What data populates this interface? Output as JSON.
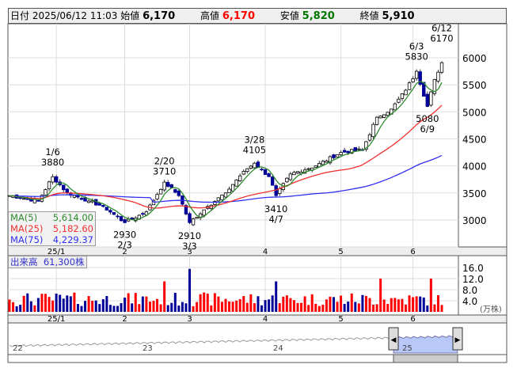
{
  "header": {
    "date_label": "日付",
    "datetime": "2025/06/12 11:03",
    "open_label": "始値",
    "open": "6,170",
    "high_label": "高値",
    "high": "6,170",
    "low_label": "安値",
    "low": "5,820",
    "close_label": "終値",
    "close": "5,910"
  },
  "ma_legend": [
    {
      "name": "MA(5)",
      "value": "5,614.00",
      "color": "#2e8b2e"
    },
    {
      "name": "MA(25)",
      "value": "5,182.60",
      "color": "#f03030"
    },
    {
      "name": "MA(75)",
      "value": "4,229.37",
      "color": "#3030f0"
    }
  ],
  "volume_legend": {
    "label": "出来高",
    "value": "61,300株"
  },
  "colors": {
    "up": "#ff0000",
    "down": "#000099"
  },
  "chart_data": {
    "type": "candlestick",
    "price_axis": {
      "ticks": [
        "6000",
        "5500",
        "5000",
        "4500",
        "4000",
        "3500",
        "3000"
      ],
      "range": [
        2500,
        6500
      ]
    },
    "x_labels": [
      {
        "label": "25/1",
        "day": 13
      },
      {
        "label": "2",
        "day": 32
      },
      {
        "label": "3",
        "day": 50
      },
      {
        "label": "4",
        "day": 71
      },
      {
        "label": "5",
        "day": 92
      },
      {
        "label": "6",
        "day": 112
      }
    ],
    "close_path": [
      [
        0,
        3450
      ],
      [
        8,
        3350
      ],
      [
        12,
        3800
      ],
      [
        16,
        3500
      ],
      [
        22,
        3350
      ],
      [
        26,
        3250
      ],
      [
        32,
        2950
      ],
      [
        38,
        3150
      ],
      [
        43,
        3700
      ],
      [
        47,
        3450
      ],
      [
        50,
        2950
      ],
      [
        55,
        3250
      ],
      [
        60,
        3500
      ],
      [
        65,
        3900
      ],
      [
        68,
        4050
      ],
      [
        72,
        3800
      ],
      [
        74,
        3450
      ],
      [
        78,
        3850
      ],
      [
        85,
        4000
      ],
      [
        92,
        4250
      ],
      [
        98,
        4300
      ],
      [
        102,
        4900
      ],
      [
        106,
        5050
      ],
      [
        110,
        5400
      ],
      [
        113,
        5750
      ],
      [
        116,
        5100
      ],
      [
        118,
        5600
      ],
      [
        120,
        5910
      ]
    ],
    "annotations": [
      {
        "date": "1/6",
        "price": "3880",
        "day": 12,
        "pos": "above"
      },
      {
        "date": "2/3",
        "price": "2930",
        "day": 32,
        "pos": "below"
      },
      {
        "date": "2/20",
        "price": "3710",
        "day": 43,
        "pos": "above"
      },
      {
        "date": "3/3",
        "price": "2910",
        "day": 50,
        "pos": "below"
      },
      {
        "date": "3/28",
        "price": "4105",
        "day": 68,
        "pos": "above"
      },
      {
        "date": "4/7",
        "price": "3410",
        "day": 74,
        "pos": "below"
      },
      {
        "date": "6/3",
        "price": "5830",
        "day": 113,
        "pos": "above"
      },
      {
        "date": "6/9",
        "price": "5080",
        "day": 116,
        "pos": "below"
      },
      {
        "date": "6/12",
        "price": "6170",
        "day": 120,
        "pos": "above"
      }
    ],
    "volume_axis": {
      "ticks": [
        "16.0",
        "12.0",
        "8.0",
        "4.0"
      ],
      "unit": "(万株)"
    },
    "navigator_labels": [
      "22",
      "23",
      "24",
      "25"
    ]
  }
}
